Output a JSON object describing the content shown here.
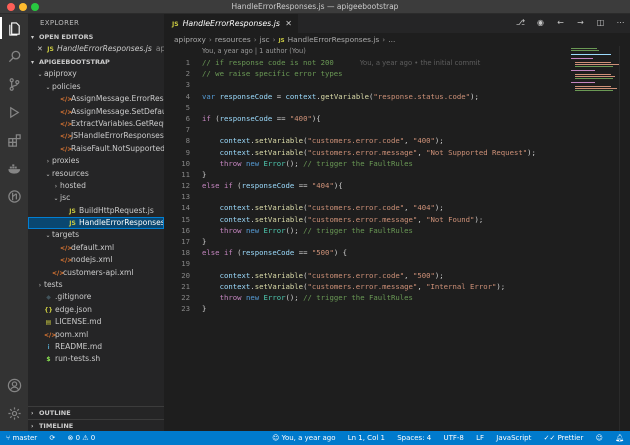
{
  "window": {
    "title": "HandleErrorResponses.js — apigeebootstrap"
  },
  "activity_bar": {
    "items": [
      {
        "icon": "files-icon",
        "selected": true
      },
      {
        "icon": "search-icon"
      },
      {
        "icon": "source-control-icon"
      },
      {
        "icon": "run-debug-icon"
      },
      {
        "icon": "extensions-icon"
      },
      {
        "icon": "docker-icon"
      },
      {
        "icon": "git-history-icon"
      }
    ],
    "bottom": [
      {
        "icon": "account-icon"
      },
      {
        "icon": "settings-gear-icon"
      }
    ]
  },
  "sidebar": {
    "title": "EXPLORER",
    "open_editors": {
      "header": "OPEN EDITORS",
      "items": [
        {
          "name": "HandleErrorResponses.js",
          "path": "apiproxy/..."
        }
      ]
    },
    "project": {
      "header": "APIGEEBOOTSTRAP",
      "tree": [
        {
          "label": "apiproxy",
          "level": 0,
          "type": "folder",
          "open": true
        },
        {
          "label": "policies",
          "level": 1,
          "type": "folder",
          "open": true
        },
        {
          "label": "AssignMessage.ErrorRespon...",
          "level": 2,
          "type": "xml"
        },
        {
          "label": "AssignMessage.SetDefaultEr...",
          "level": 2,
          "type": "xml"
        },
        {
          "label": "ExtractVariables.GetRequest...",
          "level": 2,
          "type": "xml"
        },
        {
          "label": "JSHandleErrorResponses.xml",
          "level": 2,
          "type": "xml"
        },
        {
          "label": "RaiseFault.NotSupportedReq...",
          "level": 2,
          "type": "xml"
        },
        {
          "label": "proxies",
          "level": 1,
          "type": "folder",
          "open": false
        },
        {
          "label": "resources",
          "level": 1,
          "type": "folder",
          "open": true
        },
        {
          "label": "hosted",
          "level": 2,
          "type": "folder",
          "open": false
        },
        {
          "label": "jsc",
          "level": 2,
          "type": "folder",
          "open": true
        },
        {
          "label": "BuildHttpRequest.js",
          "level": 3,
          "type": "js"
        },
        {
          "label": "HandleErrorResponses.js",
          "level": 3,
          "type": "js",
          "selected": true
        },
        {
          "label": "targets",
          "level": 1,
          "type": "folder",
          "open": true
        },
        {
          "label": "default.xml",
          "level": 2,
          "type": "xml"
        },
        {
          "label": "nodejs.xml",
          "level": 2,
          "type": "xml"
        },
        {
          "label": "customers-api.xml",
          "level": 1,
          "type": "xml"
        },
        {
          "label": "tests",
          "level": 0,
          "type": "folder",
          "open": false
        },
        {
          "label": ".gitignore",
          "level": 0,
          "type": "git"
        },
        {
          "label": "edge.json",
          "level": 0,
          "type": "json"
        },
        {
          "label": "LICENSE.md",
          "level": 0,
          "type": "lic"
        },
        {
          "label": "pom.xml",
          "level": 0,
          "type": "xml"
        },
        {
          "label": "README.md",
          "level": 0,
          "type": "md"
        },
        {
          "label": "run-tests.sh",
          "level": 0,
          "type": "sh"
        }
      ]
    },
    "outline_header": "OUTLINE",
    "timeline_header": "TIMELINE"
  },
  "editor": {
    "tab": {
      "label": "HandleErrorResponses.js",
      "icon": "JS"
    },
    "breadcrumb": [
      "apiproxy",
      "resources",
      "jsc",
      "HandleErrorResponses.js",
      "..."
    ],
    "codelens": "You, a year ago | 1 author (You)",
    "blame": "You, a year ago • the initial commit",
    "lines": [
      [
        [
          "c-com",
          "// if response code is not 200"
        ]
      ],
      [
        [
          "c-com",
          "// we raise specific error types"
        ]
      ],
      [],
      [
        [
          "c-kw",
          "var"
        ],
        [
          "c-pun",
          " "
        ],
        [
          "c-var",
          "responseCode"
        ],
        [
          "c-pun",
          " = "
        ],
        [
          "c-var",
          "context"
        ],
        [
          "c-pun",
          "."
        ],
        [
          "c-fn",
          "getVariable"
        ],
        [
          "c-pun",
          "("
        ],
        [
          "c-str",
          "\"response.status.code\""
        ],
        [
          "c-pun",
          ");"
        ]
      ],
      [],
      [
        [
          "c-ctl",
          "if"
        ],
        [
          "c-pun",
          " ("
        ],
        [
          "c-var",
          "responseCode"
        ],
        [
          "c-pun",
          " == "
        ],
        [
          "c-str",
          "\"400\""
        ],
        [
          "c-pun",
          "){"
        ]
      ],
      [],
      [
        [
          "c-pun",
          "    "
        ],
        [
          "c-var",
          "context"
        ],
        [
          "c-pun",
          "."
        ],
        [
          "c-fn",
          "setVariable"
        ],
        [
          "c-pun",
          "("
        ],
        [
          "c-str",
          "\"customers.error.code\""
        ],
        [
          "c-pun",
          ", "
        ],
        [
          "c-str",
          "\"400\""
        ],
        [
          "c-pun",
          ");"
        ]
      ],
      [
        [
          "c-pun",
          "    "
        ],
        [
          "c-var",
          "context"
        ],
        [
          "c-pun",
          "."
        ],
        [
          "c-fn",
          "setVariable"
        ],
        [
          "c-pun",
          "("
        ],
        [
          "c-str",
          "\"customers.error.message\""
        ],
        [
          "c-pun",
          ", "
        ],
        [
          "c-str",
          "\"Not Supported Request\""
        ],
        [
          "c-pun",
          ");"
        ]
      ],
      [
        [
          "c-pun",
          "    "
        ],
        [
          "c-ctl",
          "throw"
        ],
        [
          "c-pun",
          " "
        ],
        [
          "c-kw",
          "new"
        ],
        [
          "c-pun",
          " "
        ],
        [
          "c-cls",
          "Error"
        ],
        [
          "c-pun",
          "(); "
        ],
        [
          "c-com",
          "// trigger the FaultRules"
        ]
      ],
      [
        [
          "c-pun",
          "}"
        ]
      ],
      [
        [
          "c-ctl",
          "else"
        ],
        [
          "c-pun",
          " "
        ],
        [
          "c-ctl",
          "if"
        ],
        [
          "c-pun",
          " ("
        ],
        [
          "c-var",
          "responseCode"
        ],
        [
          "c-pun",
          " == "
        ],
        [
          "c-str",
          "\"404\""
        ],
        [
          "c-pun",
          "){"
        ]
      ],
      [],
      [
        [
          "c-pun",
          "    "
        ],
        [
          "c-var",
          "context"
        ],
        [
          "c-pun",
          "."
        ],
        [
          "c-fn",
          "setVariable"
        ],
        [
          "c-pun",
          "("
        ],
        [
          "c-str",
          "\"customers.error.code\""
        ],
        [
          "c-pun",
          ", "
        ],
        [
          "c-str",
          "\"404\""
        ],
        [
          "c-pun",
          ");"
        ]
      ],
      [
        [
          "c-pun",
          "    "
        ],
        [
          "c-var",
          "context"
        ],
        [
          "c-pun",
          "."
        ],
        [
          "c-fn",
          "setVariable"
        ],
        [
          "c-pun",
          "("
        ],
        [
          "c-str",
          "\"customers.error.message\""
        ],
        [
          "c-pun",
          ", "
        ],
        [
          "c-str",
          "\"Not Found\""
        ],
        [
          "c-pun",
          ");"
        ]
      ],
      [
        [
          "c-pun",
          "    "
        ],
        [
          "c-ctl",
          "throw"
        ],
        [
          "c-pun",
          " "
        ],
        [
          "c-kw",
          "new"
        ],
        [
          "c-pun",
          " "
        ],
        [
          "c-cls",
          "Error"
        ],
        [
          "c-pun",
          "(); "
        ],
        [
          "c-com",
          "// trigger the FaultRules"
        ]
      ],
      [
        [
          "c-pun",
          "}"
        ]
      ],
      [
        [
          "c-ctl",
          "else"
        ],
        [
          "c-pun",
          " "
        ],
        [
          "c-ctl",
          "if"
        ],
        [
          "c-pun",
          " ("
        ],
        [
          "c-var",
          "responseCode"
        ],
        [
          "c-pun",
          " == "
        ],
        [
          "c-str",
          "\"500\""
        ],
        [
          "c-pun",
          ") {"
        ]
      ],
      [],
      [
        [
          "c-pun",
          "    "
        ],
        [
          "c-var",
          "context"
        ],
        [
          "c-pun",
          "."
        ],
        [
          "c-fn",
          "setVariable"
        ],
        [
          "c-pun",
          "("
        ],
        [
          "c-str",
          "\"customers.error.code\""
        ],
        [
          "c-pun",
          ", "
        ],
        [
          "c-str",
          "\"500\""
        ],
        [
          "c-pun",
          ");"
        ]
      ],
      [
        [
          "c-pun",
          "    "
        ],
        [
          "c-var",
          "context"
        ],
        [
          "c-pun",
          "."
        ],
        [
          "c-fn",
          "setVariable"
        ],
        [
          "c-pun",
          "("
        ],
        [
          "c-str",
          "\"customers.error.message\""
        ],
        [
          "c-pun",
          ", "
        ],
        [
          "c-str",
          "\"Internal Error\""
        ],
        [
          "c-pun",
          ");"
        ]
      ],
      [
        [
          "c-pun",
          "    "
        ],
        [
          "c-ctl",
          "throw"
        ],
        [
          "c-pun",
          " "
        ],
        [
          "c-kw",
          "new"
        ],
        [
          "c-pun",
          " "
        ],
        [
          "c-cls",
          "Error"
        ],
        [
          "c-pun",
          "(); "
        ],
        [
          "c-com",
          "// trigger the FaultRules"
        ]
      ],
      [
        [
          "c-pun",
          "}"
        ]
      ]
    ]
  },
  "status_bar": {
    "branch": "master",
    "errors": "0",
    "warnings": "0",
    "blame": "You, a year ago",
    "position": "Ln 1, Col 1",
    "spaces": "Spaces: 4",
    "encoding": "UTF-8",
    "eol": "LF",
    "language": "JavaScript",
    "formatter": "Prettier"
  },
  "colors": {
    "accent": "#007acc",
    "selection": "#094771",
    "sidebar_bg": "#252526",
    "editor_bg": "#1e1e1e"
  }
}
